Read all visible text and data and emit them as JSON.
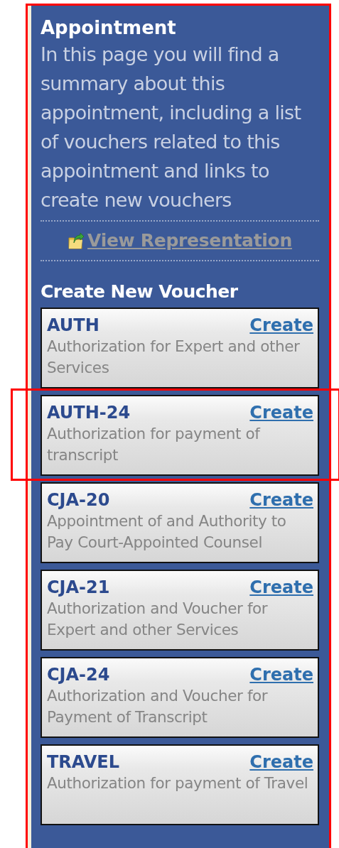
{
  "panel": {
    "title": "Appointment",
    "intro": "In this page you will find a summary about this appointment, including a list of vouchers related to this appointment and links to create new vouchers",
    "link": "View Representation"
  },
  "section_title": "Create New Voucher",
  "vouchers": [
    {
      "code": "AUTH",
      "action": "Create",
      "description": "Authorization for Expert and other Services",
      "highlighted": false
    },
    {
      "code": "AUTH-24",
      "action": "Create",
      "description": "Authorization for payment of transcript",
      "highlighted": true
    },
    {
      "code": "CJA-20",
      "action": "Create",
      "description": "Appointment of and Authority to Pay Court-Appointed Counsel",
      "highlighted": false
    },
    {
      "code": "CJA-21",
      "action": "Create",
      "description": "Authorization and Voucher for Expert and other Services",
      "highlighted": false
    },
    {
      "code": "CJA-24",
      "action": "Create",
      "description": "Authorization and Voucher for Payment of Transcript",
      "highlighted": false
    },
    {
      "code": "TRAVEL",
      "action": "Create",
      "description": "Authorization for payment of Travel",
      "highlighted": false
    }
  ]
}
